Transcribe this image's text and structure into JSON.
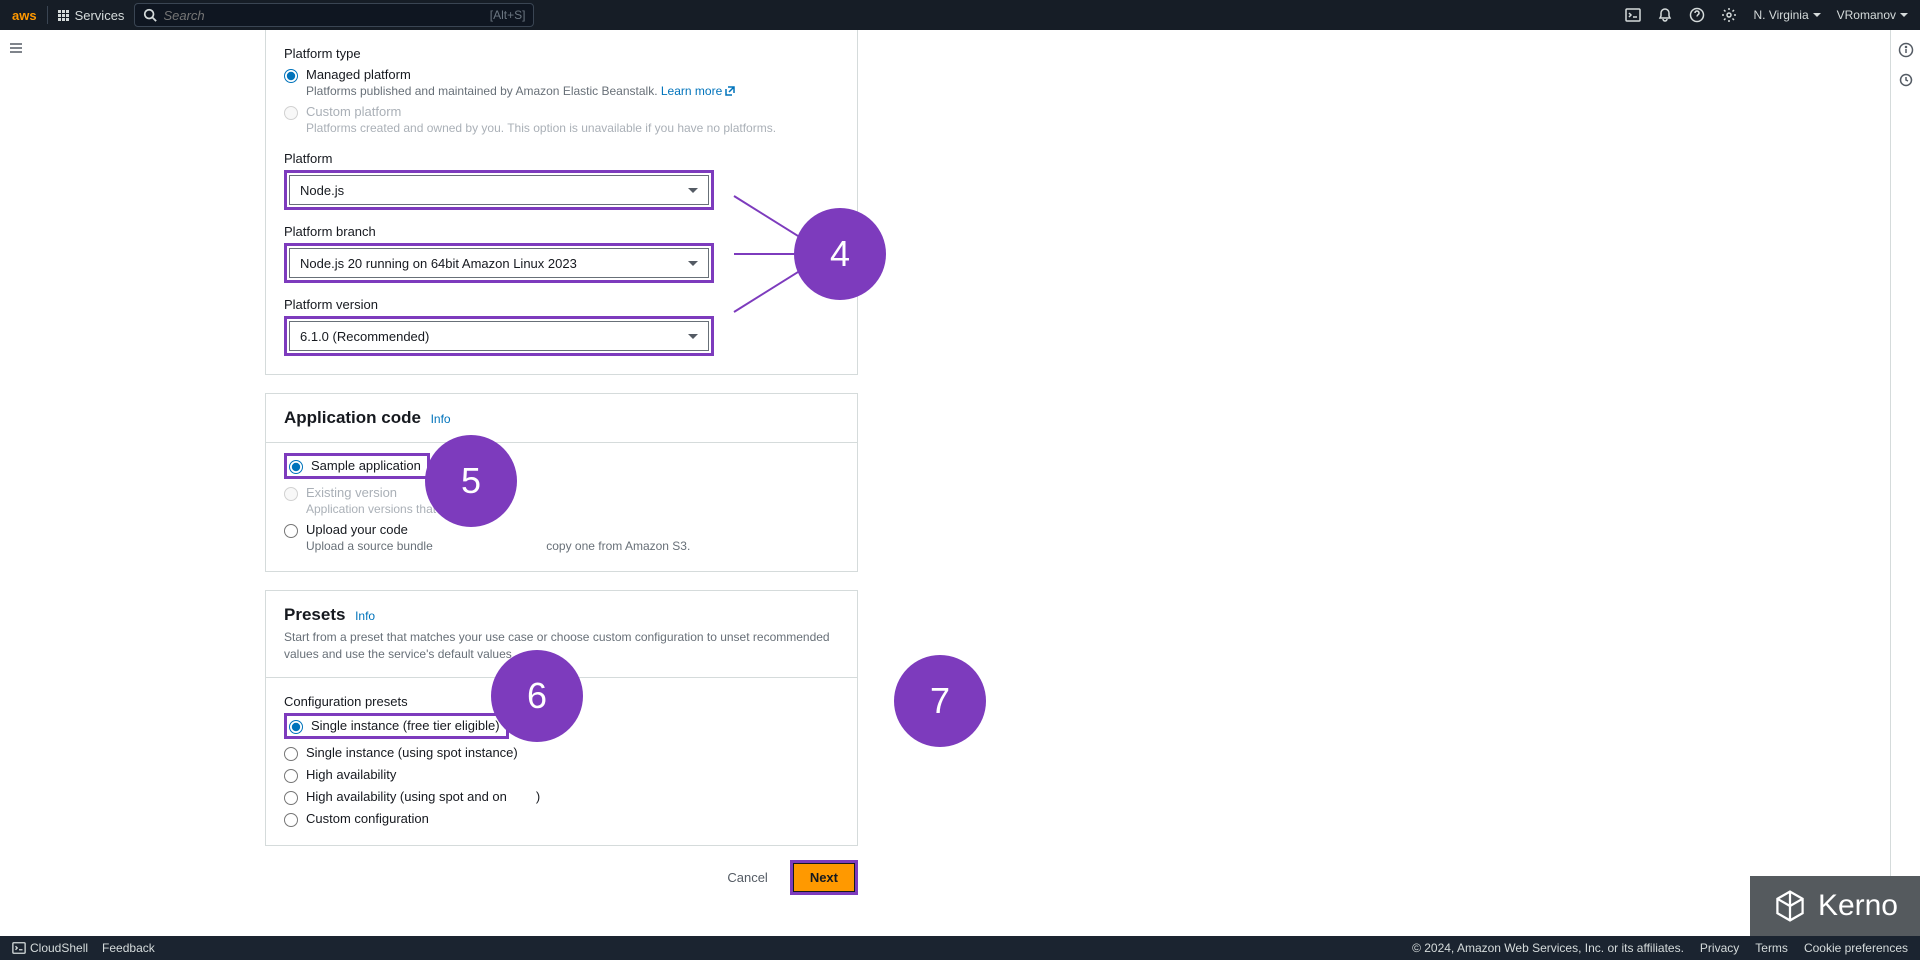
{
  "nav": {
    "logo": "aws",
    "services": "Services",
    "search_placeholder": "Search",
    "search_hint": "[Alt+S]",
    "region": "N. Virginia",
    "user": "VRomanov"
  },
  "platform_section": {
    "type_label": "Platform type",
    "managed": {
      "label": "Managed platform",
      "desc": "Platforms published and maintained by Amazon Elastic Beanstalk.",
      "learn": "Learn more"
    },
    "custom": {
      "label": "Custom platform",
      "desc": "Platforms created and owned by you. This option is unavailable if you have no platforms."
    },
    "platform_label": "Platform",
    "platform_value": "Node.js",
    "branch_label": "Platform branch",
    "branch_value": "Node.js 20 running on 64bit Amazon Linux 2023",
    "version_label": "Platform version",
    "version_value": "6.1.0 (Recommended)"
  },
  "appcode": {
    "title": "Application code",
    "info": "Info",
    "sample": "Sample application",
    "existing": {
      "label": "Existing version",
      "desc": "Application versions that"
    },
    "upload": {
      "label": "Upload your code",
      "desc_a": "Upload a source bundle",
      "desc_b": "copy one from Amazon S3."
    }
  },
  "presets": {
    "title": "Presets",
    "info": "Info",
    "desc": "Start from a preset that matches your use case or choose custom configuration to unset recommended values and use the service's default values.",
    "cfg_label": "Configuration presets",
    "opts": {
      "single": "Single instance (free tier eligible)",
      "spot": "Single instance (using spot instance)",
      "ha": "High availability",
      "haspot": "High availability (using spot and on",
      "custom": "Custom configuration"
    }
  },
  "buttons": {
    "cancel": "Cancel",
    "next": "Next"
  },
  "footer": {
    "cloudshell": "CloudShell",
    "feedback": "Feedback",
    "copyright": "© 2024, Amazon Web Services, Inc. or its affiliates.",
    "privacy": "Privacy",
    "terms": "Terms",
    "cookies": "Cookie preferences"
  },
  "anno": {
    "a4": "4",
    "a5": "5",
    "a6": "6",
    "a7": "7"
  },
  "watermark": "Kerno"
}
